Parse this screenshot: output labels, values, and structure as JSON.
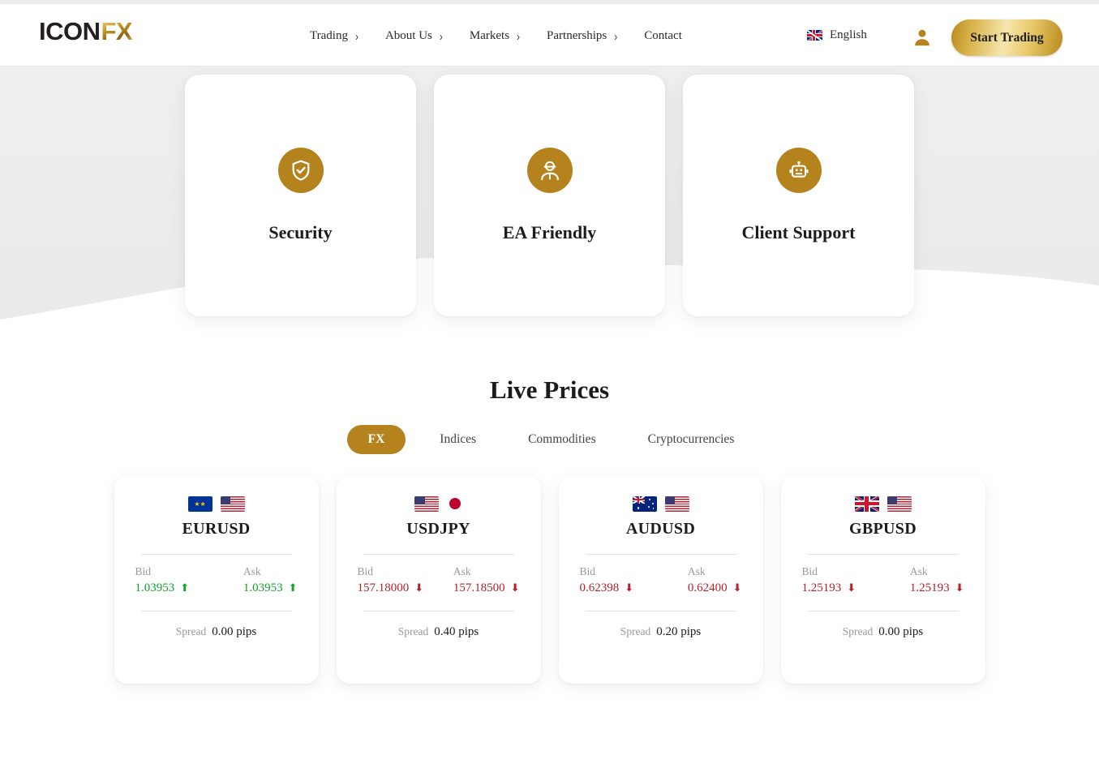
{
  "brand": {
    "logo_primary": "ICON",
    "logo_accent": "FX",
    "gold": "#b5831e"
  },
  "header": {
    "nav": [
      {
        "label": "Trading",
        "has_dropdown": true,
        "icon": "chevron-right-icon"
      },
      {
        "label": "About Us",
        "has_dropdown": true,
        "icon": "chevron-right-icon"
      },
      {
        "label": "Markets",
        "has_dropdown": true,
        "icon": "chevron-right-icon"
      },
      {
        "label": "Partnerships",
        "has_dropdown": true,
        "icon": "chevron-right-icon"
      },
      {
        "label": "Contact",
        "has_dropdown": false,
        "icon": ""
      }
    ],
    "language": {
      "label": "English",
      "flag": "uk-flag-icon"
    },
    "account_icon": "user-account-icon",
    "cta_label": "Start Trading"
  },
  "features": [
    {
      "title": "Security",
      "icon": "shield-check-icon"
    },
    {
      "title": "EA Friendly",
      "icon": "support-agent-icon"
    },
    {
      "title": "Client Support",
      "icon": "robot-icon"
    }
  ],
  "live_prices": {
    "title": "Live Prices",
    "tabs": [
      {
        "label": "FX",
        "active": true
      },
      {
        "label": "Indices",
        "active": false
      },
      {
        "label": "Commodities",
        "active": false
      },
      {
        "label": "Cryptocurrencies",
        "active": false
      }
    ],
    "labels": {
      "bid": "Bid",
      "ask": "Ask",
      "spread": "Spread"
    },
    "cards": [
      {
        "pair": "EURUSD",
        "flag_left": "eu-flag-icon",
        "flag_right": "us-flag-icon",
        "bid": "1.03953",
        "ask": "1.03953",
        "bid_dir": "up",
        "ask_dir": "up",
        "spread": "0.00 pips",
        "up_color": "#13a32b"
      },
      {
        "pair": "USDJPY",
        "flag_left": "us-flag-icon",
        "flag_right": "jp-flag-icon",
        "bid": "157.18000",
        "ask": "157.18500",
        "bid_dir": "down",
        "ask_dir": "down",
        "spread": "0.40 pips",
        "down_color": "#b4232b"
      },
      {
        "pair": "AUDUSD",
        "flag_left": "au-flag-icon",
        "flag_right": "us-flag-icon",
        "bid": "0.62398",
        "ask": "0.62400",
        "bid_dir": "down",
        "ask_dir": "down",
        "spread": "0.20 pips",
        "down_color": "#b4232b"
      },
      {
        "pair": "GBPUSD",
        "flag_left": "gb-flag-icon",
        "flag_right": "us-flag-icon",
        "bid": "1.25193",
        "ask": "1.25193",
        "bid_dir": "down",
        "ask_dir": "down",
        "spread": "0.00 pips",
        "down_color": "#b4232b"
      }
    ],
    "arrow_up_glyph": "⬆",
    "arrow_down_glyph": "⬇"
  }
}
